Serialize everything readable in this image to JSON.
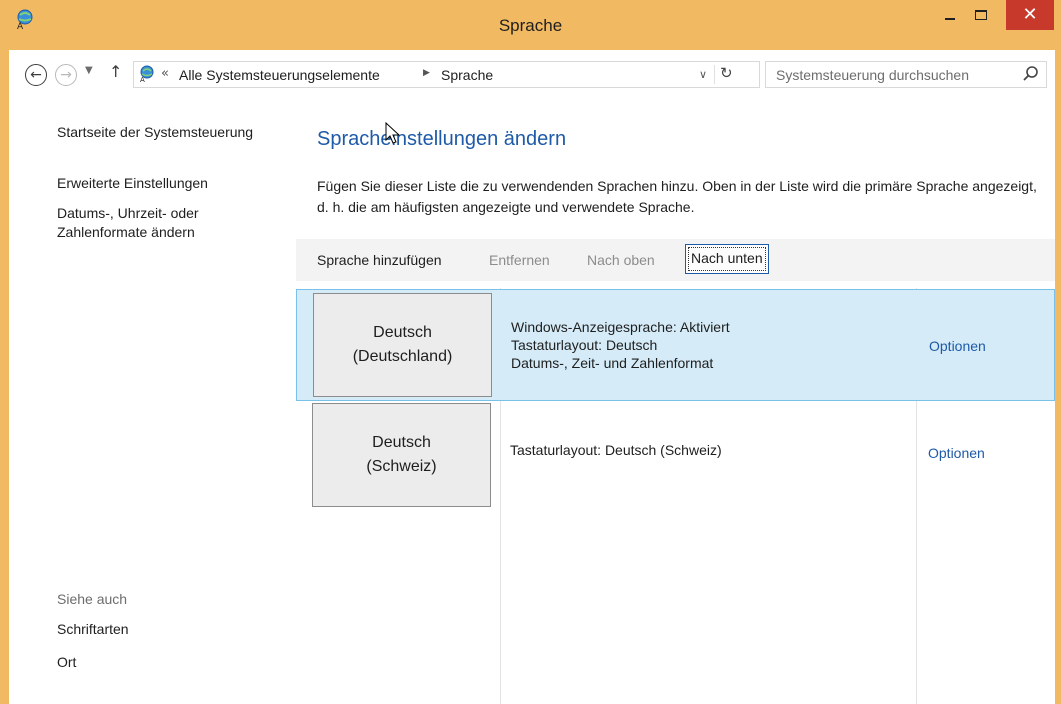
{
  "window": {
    "title": "Sprache",
    "minimize_label": "",
    "maximize_label": "",
    "close_label": "✕",
    "accent": "#f0b962",
    "close_color": "#c7392b"
  },
  "navbar": {
    "back_glyph": "←",
    "forward_glyph": "→",
    "dropdown_glyph": "▼",
    "up_glyph": "↑",
    "breadcrumb_chevron": "«",
    "breadcrumb_1": "Alle Systemsteuerungselemente",
    "breadcrumb_sep": "▶",
    "breadcrumb_2": "Sprache",
    "address_dropdown": "∨",
    "refresh_glyph": "↻",
    "search_placeholder": "Systemsteuerung durchsuchen"
  },
  "sidebar": {
    "home": "Startseite der Systemsteuerung",
    "advanced": "Erweiterte Einstellungen",
    "date_formats": "Datums-, Uhrzeit- oder Zahlenformate ändern",
    "see_also": "Siehe auch",
    "fonts": "Schriftarten",
    "location": "Ort"
  },
  "main": {
    "title": "Spracheinstellungen ändern",
    "description": "Fügen Sie dieser Liste die zu verwendenden Sprachen hinzu. Oben in der Liste wird die primäre Sprache angezeigt, d. h. die am häufigsten angezeigte und verwendete Sprache.",
    "toolbar": {
      "add": "Sprache hinzufügen",
      "remove": "Entfernen",
      "move_up": "Nach oben",
      "move_down": "Nach unten"
    },
    "languages": [
      {
        "name_line1": "Deutsch",
        "name_line2": "(Deutschland)",
        "detail_1": "Windows-Anzeigesprache: Aktiviert",
        "detail_2": "Tastaturlayout: Deutsch",
        "detail_3": "Datums-, Zeit- und Zahlenformat",
        "options": "Optionen",
        "selected": true
      },
      {
        "name_line1": "Deutsch",
        "name_line2": "(Schweiz)",
        "detail_1": "Tastaturlayout: Deutsch (Schweiz)",
        "options": "Optionen",
        "selected": false
      }
    ]
  },
  "colors": {
    "link_blue": "#1e5aa8",
    "selection_bg": "#d5ecf8",
    "selection_border": "#7ac1ea",
    "disabled_text": "#8c8c8c"
  }
}
